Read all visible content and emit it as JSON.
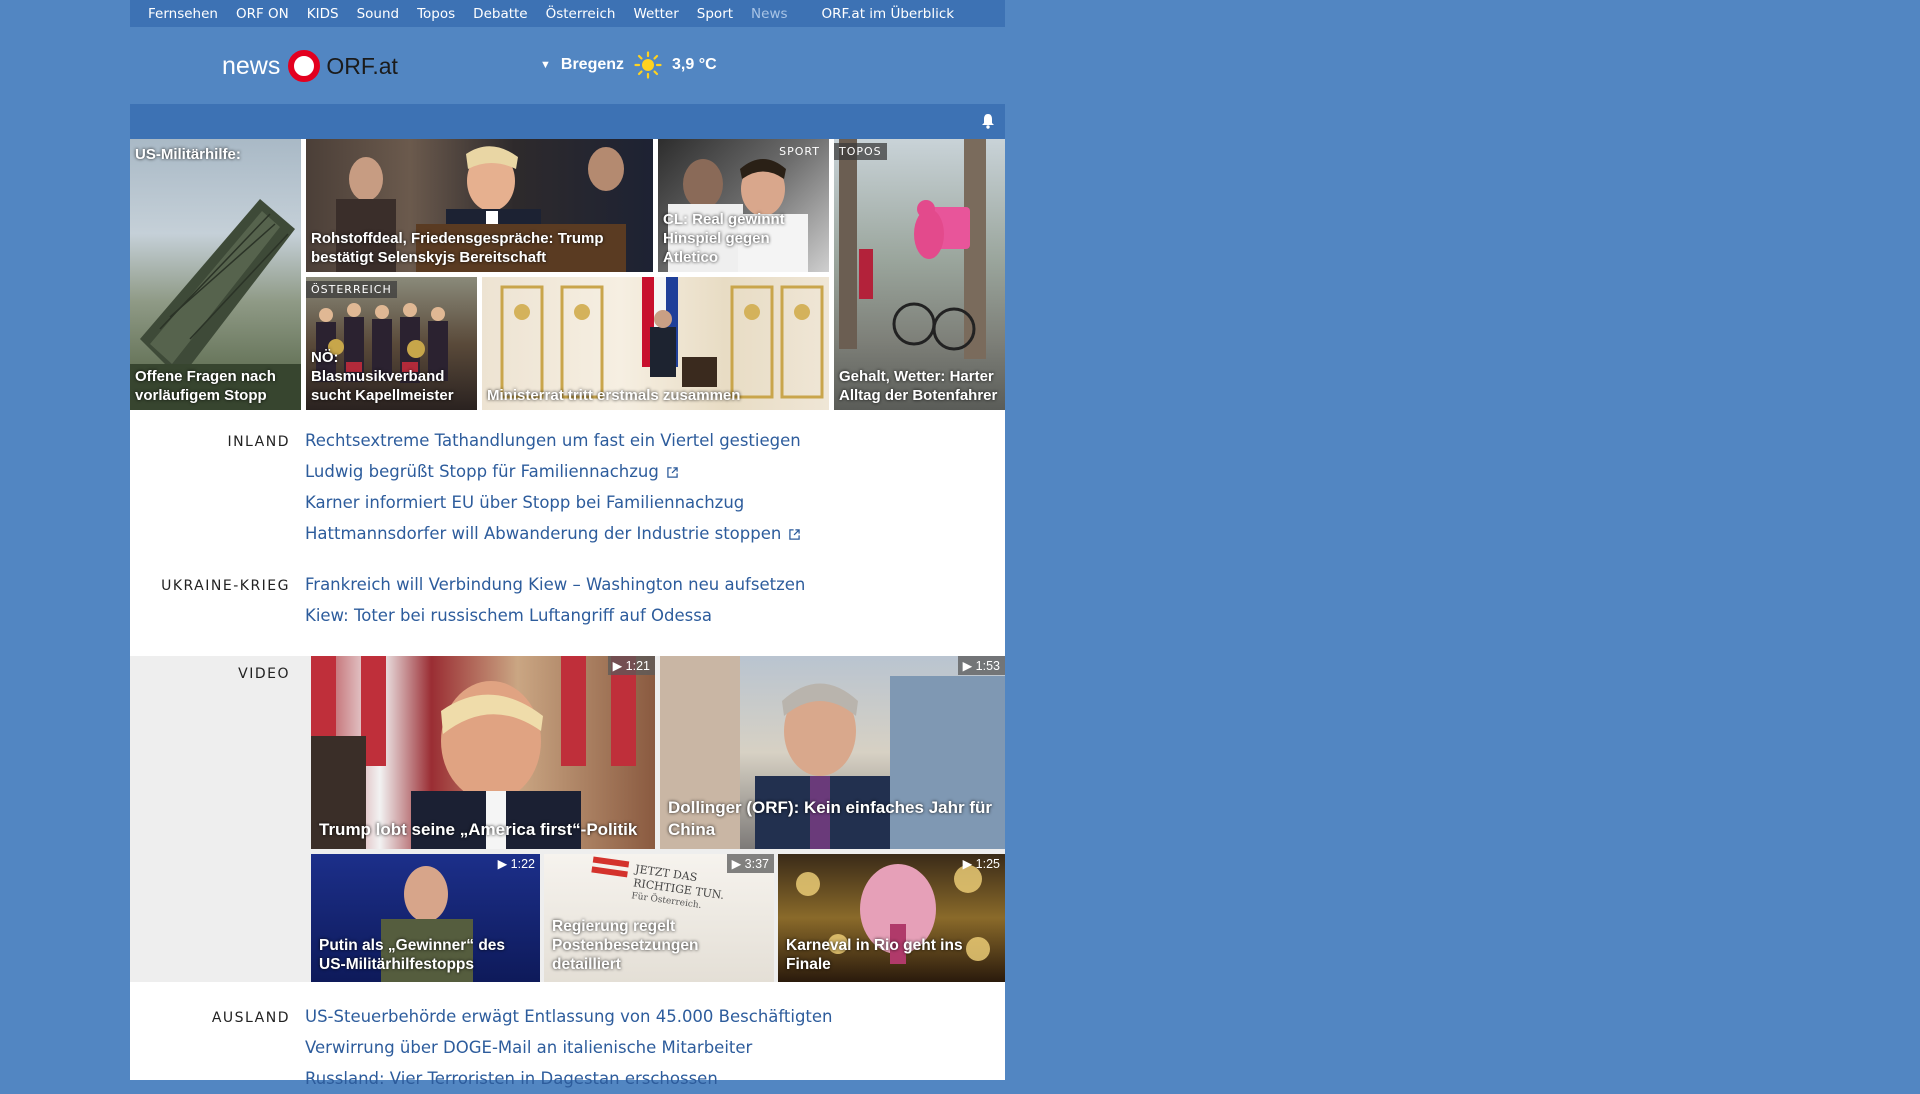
{
  "topnav": {
    "items": [
      "Fernsehen",
      "ORF ON",
      "KIDS",
      "Sound",
      "Topos",
      "Debatte",
      "Österreich",
      "Wetter",
      "Sport",
      "News"
    ],
    "overview": "ORF.at im Überblick",
    "active": "News"
  },
  "brand": {
    "news": "news",
    "orf": "ORF.at"
  },
  "weather": {
    "location": "Bregenz",
    "temp": "3,9 °C",
    "icon": "sun-icon"
  },
  "tiles": {
    "military": {
      "top": "US-Militärhilfe:",
      "caption": "Offene Fragen nach vorläufigem Stopp"
    },
    "trump": {
      "caption": "Rohstoffdeal, Friedensgespräche: Trump bestätigt Selenskyjs Bereitschaft"
    },
    "sport": {
      "tag": "SPORT",
      "caption": "CL: Real gewinnt Hinspiel gegen Atletico"
    },
    "topos": {
      "tag": "TOPOS",
      "caption": "Gehalt, Wetter: Harter Alltag der Botenfahrer"
    },
    "oesterreich": {
      "tag": "ÖSTERREICH",
      "caption": "NÖ: Blasmusikverband sucht Kapellmeister"
    },
    "ministerrat": {
      "caption": "Ministerrat tritt erstmals zusammen"
    }
  },
  "inland": {
    "label": "INLAND",
    "links": [
      {
        "text": "Rechtsextreme Tathandlungen um fast ein Viertel gestiegen",
        "external": false
      },
      {
        "text": "Ludwig begrüßt Stopp für Familiennachzug",
        "external": true
      },
      {
        "text": "Karner informiert EU über Stopp bei Familiennachzug",
        "external": false
      },
      {
        "text": "Hattmannsdorfer will Abwanderung der Industrie stoppen",
        "external": true
      }
    ]
  },
  "ukraine": {
    "label": "UKRAINE-KRIEG",
    "links": [
      {
        "text": "Frankreich will Verbindung Kiew – Washington neu aufsetzen"
      },
      {
        "text": "Kiew: Toter bei russischem Luftangriff auf Odessa"
      }
    ]
  },
  "video": {
    "label": "VIDEO",
    "items": [
      {
        "caption": "Trump lobt seine „America first“-Politik",
        "duration": "1:21"
      },
      {
        "caption": "Dollinger (ORF): Kein einfaches Jahr für China",
        "duration": "1:53"
      },
      {
        "caption": "Putin als „Gewinner“ des US-Militärhilfestopps",
        "duration": "1:22"
      },
      {
        "caption": "Regierung regelt Postenbesetzungen detailliert",
        "duration": "3:37"
      },
      {
        "caption": "Karneval in Rio geht ins Finale",
        "duration": "1:25"
      }
    ],
    "poster_text": "JETZT DAS RICHTIGE TUN. Für Österreich."
  },
  "ausland": {
    "label": "AUSLAND",
    "links": [
      {
        "text": "US-Steuerbehörde erwägt Entlassung von 45.000 Beschäftigten"
      },
      {
        "text": "Verwirrung über DOGE-Mail an italienische Mitarbeiter"
      },
      {
        "text": "Russland: Vier Terroristen in Dagestan erschossen"
      }
    ]
  }
}
